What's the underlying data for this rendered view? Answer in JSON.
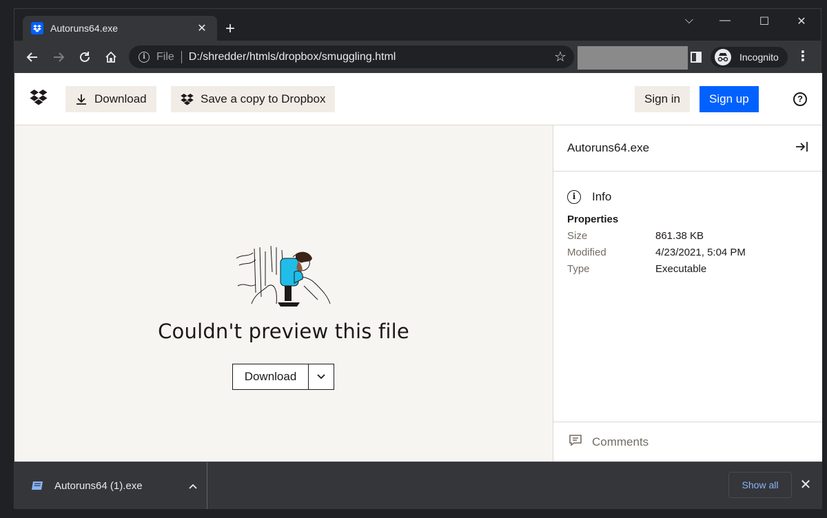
{
  "browser": {
    "tab": {
      "title": "Autoruns64.exe",
      "favicon": "dropbox-icon",
      "close_glyph": "✕"
    },
    "new_tab_glyph": "+",
    "window_controls": {
      "tabsearch": "⌵",
      "minimize": "—",
      "maximize": "☐",
      "close": "✕"
    },
    "omnibox": {
      "scheme_label": "File",
      "url": "D:/shredder/htmls/dropbox/smuggling.html",
      "bookmark_glyph": "☆"
    },
    "profile": {
      "label": "Incognito"
    },
    "menu_glyph": "⋮"
  },
  "header": {
    "download_label": "Download",
    "save_copy_label": "Save a copy to Dropbox",
    "signin_label": "Sign in",
    "signup_label": "Sign up",
    "help_glyph": "?"
  },
  "preview": {
    "message": "Couldn't preview this file",
    "download_label": "Download"
  },
  "sidebar": {
    "filename": "Autoruns64.exe",
    "info_label": "Info",
    "properties_title": "Properties",
    "properties": [
      {
        "key": "Size",
        "value": "861.38 KB"
      },
      {
        "key": "Modified",
        "value": "4/23/2021, 5:04 PM"
      },
      {
        "key": "Type",
        "value": "Executable"
      }
    ],
    "comments_label": "Comments"
  },
  "download_shelf": {
    "filename": "Autoruns64 (1).exe",
    "show_all_label": "Show all",
    "close_glyph": "✕"
  },
  "colors": {
    "dropbox_blue": "#0061fe",
    "chrome_dark": "#202124",
    "chrome_toolbar": "#35363a",
    "preview_bg": "#f7f5f2",
    "button_beige": "#f1ece6",
    "link_blue": "#8ab4f8"
  }
}
